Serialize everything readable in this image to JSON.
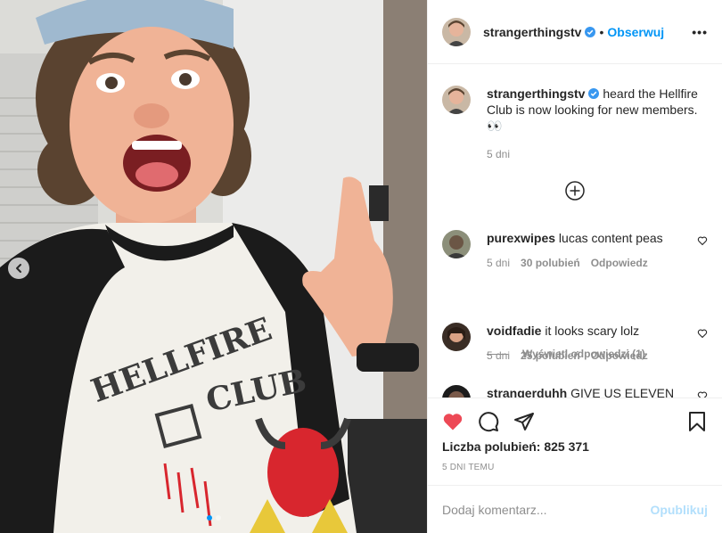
{
  "post": {
    "photo": {
      "shirt_text_line1": "HELLFIRE",
      "shirt_text_line2": "CLUB",
      "nav_prev_icon": "chevron-left-icon",
      "dots": 2,
      "active_dot": 0
    },
    "header": {
      "username": "strangerthingstv",
      "separator": "•",
      "follow_label": "Obserwuj",
      "more_icon": "more-horizontal-icon",
      "more_label": "•••"
    },
    "caption": {
      "username": "strangerthingstv",
      "text": "heard the Hellfire Club is now looking for new members. 👀",
      "time": "5 dni"
    },
    "load_more_icon": "plus-circle-icon",
    "comments": [
      {
        "username": "purexwipes",
        "text": "lucas content peas",
        "time": "5 dni",
        "likes": "30 polubień",
        "reply": "Odpowiedz"
      },
      {
        "username": "voidfadie",
        "text": "it looks scary lolz",
        "time": "5 dni",
        "likes": "25 polubień",
        "reply": "Odpowiedz"
      },
      {
        "username": "strangerduhh",
        "text": "GIVE US ELEVEN"
      }
    ],
    "view_replies": "Wyświetl odpowiedzi (1)",
    "actions": {
      "like_icon": "heart-filled-icon",
      "comment_icon": "comment-icon",
      "share_icon": "send-icon",
      "save_icon": "bookmark-icon"
    },
    "likes_text": "Liczba polubień: 825 371",
    "date_text": "5 DNI TEMU",
    "add_comment": {
      "placeholder": "Dodaj komentarz...",
      "publish_label": "Opublikuj"
    },
    "colors": {
      "accent": "#0095f6",
      "like_red": "#ed4956",
      "muted": "#8e8e8e",
      "publish_disabled": "#b2dffc"
    }
  }
}
